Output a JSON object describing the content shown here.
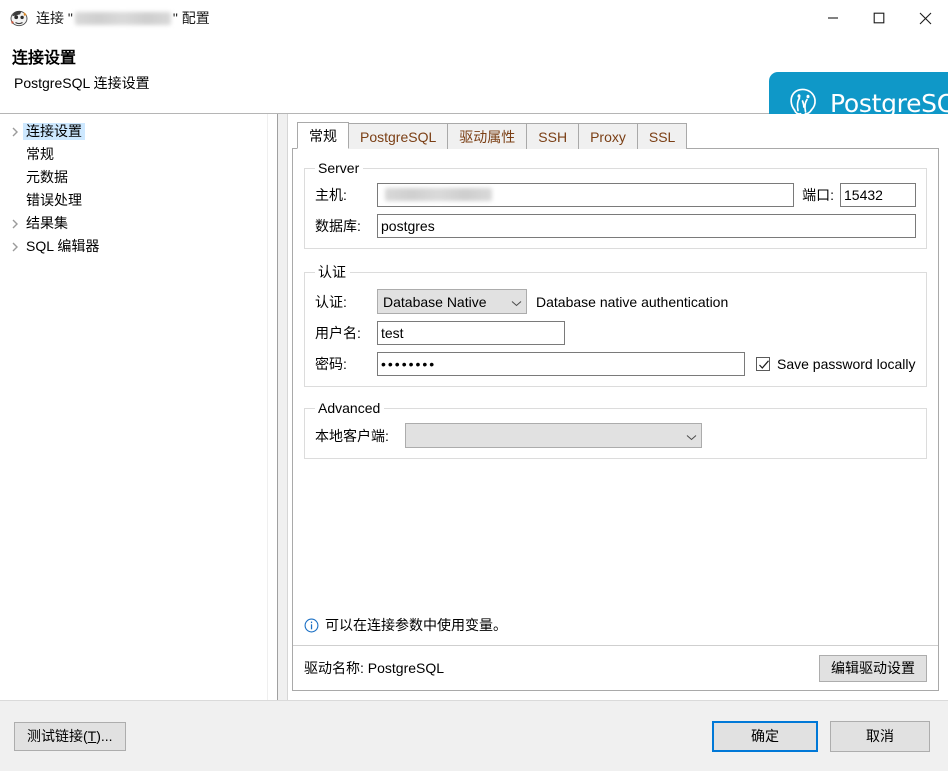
{
  "window": {
    "icon": "dbeaver-icon",
    "title_prefix": "连接 \"",
    "title_redacted": "",
    "title_suffix": "\" 配置",
    "minimize_label": "minimize-icon",
    "maximize_label": "maximize-icon",
    "close_label": "close-icon"
  },
  "header": {
    "title": "连接设置",
    "subtitle": "PostgreSQL 连接设置",
    "banner_text": "PostgreSQL",
    "banner_color": "#0f98c8"
  },
  "sidebar": {
    "items": [
      {
        "label": "连接设置",
        "expandable": true,
        "selected": true
      },
      {
        "label": "常规",
        "expandable": false,
        "selected": false
      },
      {
        "label": "元数据",
        "expandable": false,
        "selected": false
      },
      {
        "label": "错误处理",
        "expandable": false,
        "selected": false
      },
      {
        "label": "结果集",
        "expandable": true,
        "selected": false
      },
      {
        "label": "SQL 编辑器",
        "expandable": true,
        "selected": false
      }
    ]
  },
  "tabs": [
    {
      "label": "常规",
      "active": true
    },
    {
      "label": "PostgreSQL",
      "active": false
    },
    {
      "label": "驱动属性",
      "active": false
    },
    {
      "label": "SSH",
      "active": false
    },
    {
      "label": "Proxy",
      "active": false
    },
    {
      "label": "SSL",
      "active": false
    }
  ],
  "server": {
    "legend": "Server",
    "host_label": "主机:",
    "host_value": "",
    "port_label": "端口:",
    "port_value": "15432",
    "db_label": "数据库:",
    "db_value": "postgres"
  },
  "auth": {
    "legend": "认证",
    "auth_label": "认证:",
    "auth_value": "Database Native",
    "auth_options": [
      "Database Native"
    ],
    "auth_desc": "Database native authentication",
    "user_label": "用户名:",
    "user_value": "test",
    "pass_label": "密码:",
    "pass_value": "••••••••",
    "save_password_label": "Save password locally",
    "save_password_checked": true
  },
  "advanced": {
    "legend": "Advanced",
    "client_label": "本地客户端:",
    "client_value": "",
    "client_options": [
      ""
    ]
  },
  "hint": {
    "icon": "info-icon",
    "text": "可以在连接参数中使用变量。",
    "icon_color": "#1a6fc4"
  },
  "driver": {
    "name_label": "驱动名称: PostgreSQL",
    "edit_button": "编辑驱动设置"
  },
  "footer": {
    "test_button": "测试链接(T)...",
    "test_button_plain": "测试链接(",
    "test_button_mnemonic": "T",
    "test_button_tail": ")...",
    "ok_button": "确定",
    "cancel_button": "取消",
    "ok_accent": "#0078d7"
  }
}
